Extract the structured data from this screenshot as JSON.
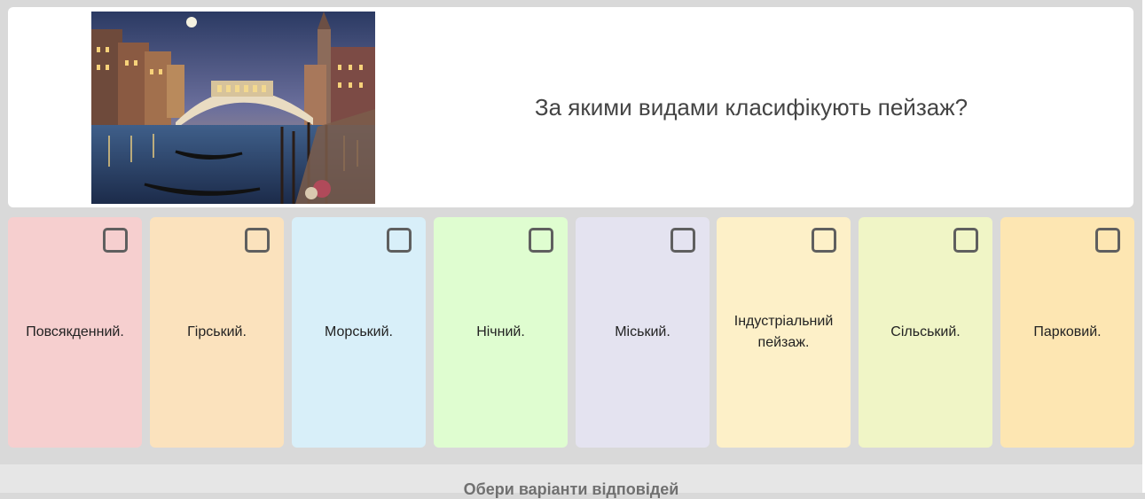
{
  "question": {
    "text": "За якими видами класифікують пейзаж?",
    "image_subject": "venice-canal-bridge-painting"
  },
  "answers": [
    {
      "label": "Повсякденний.",
      "color": "#f6cfcf",
      "checked": false
    },
    {
      "label": "Гірський.",
      "color": "#fbe2bd",
      "checked": false
    },
    {
      "label": "Морський.",
      "color": "#d8eff9",
      "checked": false
    },
    {
      "label": "Нічний.",
      "color": "#dffdd0",
      "checked": false
    },
    {
      "label": "Міський.",
      "color": "#e4e3f0",
      "checked": false
    },
    {
      "label": "Індустріальний пейзаж.",
      "color": "#fdf0c8",
      "checked": false
    },
    {
      "label": "Сільський.",
      "color": "#f0f5c6",
      "checked": false
    },
    {
      "label": "Парковий.",
      "color": "#fde6b2",
      "checked": false
    }
  ],
  "footer": {
    "instruction": "Обери варіанти відповідей"
  }
}
